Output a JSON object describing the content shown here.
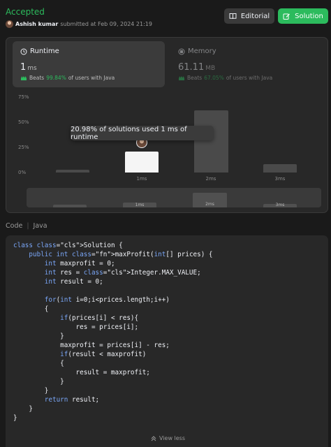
{
  "header": {
    "status": "Accepted",
    "user_name": "Ashish kumar",
    "submitted_text": "submitted at Feb 09, 2024 21:19",
    "editorial_label": "Editorial",
    "solution_label": "Solution"
  },
  "runtime": {
    "title": "Runtime",
    "value": "1",
    "unit": "ms",
    "beats_prefix": "Beats",
    "beats_pct": "99.84%",
    "beats_suffix": "of users with Java"
  },
  "memory": {
    "title": "Memory",
    "value": "61.11",
    "unit": "MB",
    "beats_prefix": "Beats",
    "beats_pct": "67.05%",
    "beats_suffix": "of users with Java"
  },
  "tooltip": "20.98% of solutions used 1 ms of runtime",
  "chart_data": {
    "type": "bar",
    "yticks": [
      "75%",
      "50%",
      "25%",
      "0%"
    ],
    "ylim": [
      0,
      75
    ],
    "categories": [
      "",
      "1ms",
      "2ms",
      "3ms"
    ],
    "values": [
      3,
      21,
      62,
      8
    ],
    "highlight_index": 1,
    "mini_labels": [
      "",
      "1ms",
      "2ms",
      "3ms"
    ]
  },
  "code": {
    "label": "Code",
    "language": "Java",
    "lines": [
      "class Solution {",
      "    public int maxProfit(int[] prices) {",
      "        int maxprofit = 0;",
      "        int res = Integer.MAX_VALUE;",
      "        int result = 0;",
      "",
      "        for(int i=0;i<prices.length;i++)",
      "        {",
      "            if(prices[i] < res){",
      "                res = prices[i];",
      "            }",
      "            maxprofit = prices[i] - res;",
      "            if(result < maxprofit)",
      "            {",
      "                result = maxprofit;",
      "            }",
      "        }",
      "        return result;",
      "    }",
      "}"
    ]
  },
  "view_less": "View less",
  "colors": {
    "accent_green": "#2cbb5d",
    "keyword_blue": "#7aa6f7",
    "class_teal": "#4fc1b4"
  }
}
